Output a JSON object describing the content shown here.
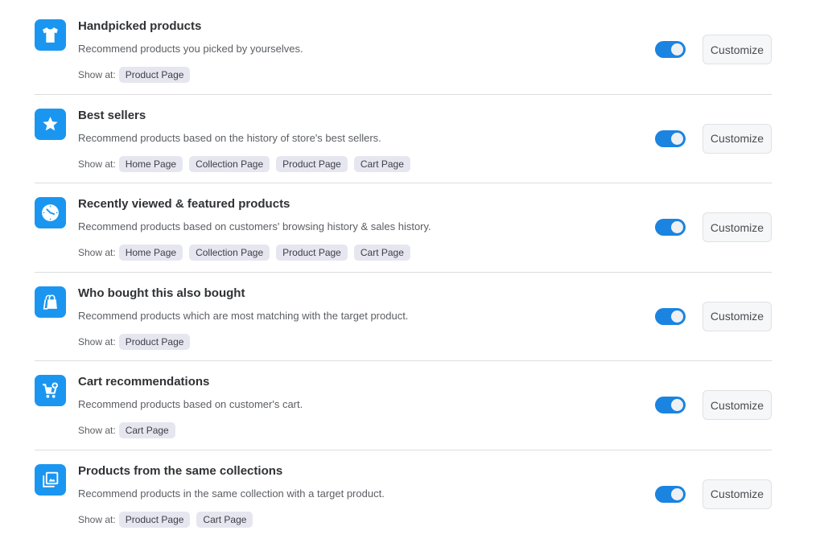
{
  "show_at_label": "Show at:",
  "customize_label": "Customize",
  "accent_color": "#1a96f0",
  "widgets": [
    {
      "icon": "tshirt-icon",
      "title": "Handpicked products",
      "description": "Recommend products you picked by yourselves.",
      "pages": [
        "Product Page"
      ],
      "enabled": true
    },
    {
      "icon": "star-icon",
      "title": "Best sellers",
      "description": "Recommend products based on the history of store's best sellers.",
      "pages": [
        "Home Page",
        "Collection Page",
        "Product Page",
        "Cart Page"
      ],
      "enabled": true
    },
    {
      "icon": "clock-icon",
      "title": "Recently viewed & featured products",
      "description": "Recommend products based on customers' browsing history & sales history.",
      "pages": [
        "Home Page",
        "Collection Page",
        "Product Page",
        "Cart Page"
      ],
      "enabled": true
    },
    {
      "icon": "shopping-bags-icon",
      "title": "Who bought this also bought",
      "description": "Recommend products which are most matching with the target product.",
      "pages": [
        "Product Page"
      ],
      "enabled": true
    },
    {
      "icon": "cart-add-icon",
      "title": "Cart recommendations",
      "description": "Recommend products based on customer's cart.",
      "pages": [
        "Cart Page"
      ],
      "enabled": true
    },
    {
      "icon": "image-collection-icon",
      "title": "Products from the same collections",
      "description": "Recommend products in the same collection with a target product.",
      "pages": [
        "Product Page",
        "Cart Page"
      ],
      "enabled": true
    }
  ]
}
